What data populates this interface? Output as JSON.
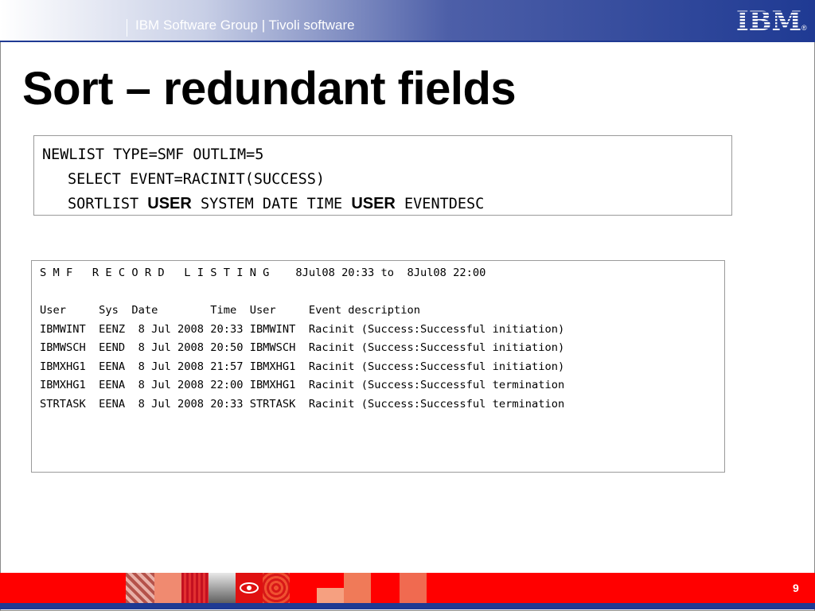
{
  "header": {
    "text": "IBM Software Group | Tivoli software",
    "logo_text": "IBM",
    "registered": "®"
  },
  "slide": {
    "title": "Sort – redundant fields",
    "page_number": "9"
  },
  "code": {
    "line1": "NEWLIST TYPE=SMF OUTLIM=5",
    "line2": "SELECT EVENT=RACINIT(SUCCESS)",
    "line3_a": "SORTLIST ",
    "line3_b": "USER",
    "line3_c": " SYSTEM DATE TIME ",
    "line3_d": "USER",
    "line3_e": " EVENTDESC"
  },
  "listing": {
    "banner": "S M F   R E C O R D   L I S T I N G    8Jul08 20:33 to  8Jul08 22:00",
    "header_row": "User     Sys  Date        Time  User     Event description",
    "rows": [
      "IBMWINT  EENZ  8 Jul 2008 20:33 IBMWINT  Racinit (Success:Successful initiation)",
      "IBMWSCH  EEND  8 Jul 2008 20:50 IBMWSCH  Racinit (Success:Successful initiation)",
      "IBMXHG1  EENA  8 Jul 2008 21:57 IBMXHG1  Racinit (Success:Successful initiation)",
      "IBMXHG1  EENA  8 Jul 2008 22:00 IBMXHG1  Racinit (Success:Successful termination",
      "STRTASK  EENA  8 Jul 2008 20:33 STRTASK  Racinit (Success:Successful termination"
    ]
  },
  "colors": {
    "brand_blue": "#1f3a93",
    "footer_red": "#ff0000"
  }
}
